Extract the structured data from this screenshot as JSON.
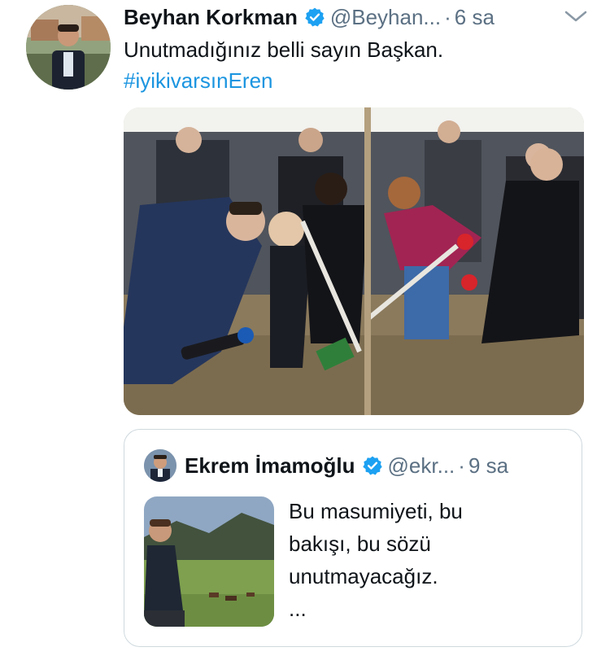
{
  "tweet": {
    "author_name": "Beyhan Korkman",
    "handle": "@Beyhan...",
    "separator": "·",
    "time": "6 sa",
    "text": "Unutmadığınız belli sayın Başkan.",
    "hashtag": "#iyikivarsınEren",
    "verified_color": "#1da1f2",
    "link_color": "#1b95e0"
  },
  "quoted": {
    "author_name": "Ekrem İmamoğlu",
    "handle": "@ekr...",
    "separator": "·",
    "time": "9 sa",
    "text_lines": [
      "Bu masumiyeti, bu",
      "bakışı, bu sözü",
      "unutmayacağız.",
      "..."
    ]
  },
  "icons": {
    "verified": "verified-badge-icon",
    "more": "chevron-down-icon"
  }
}
